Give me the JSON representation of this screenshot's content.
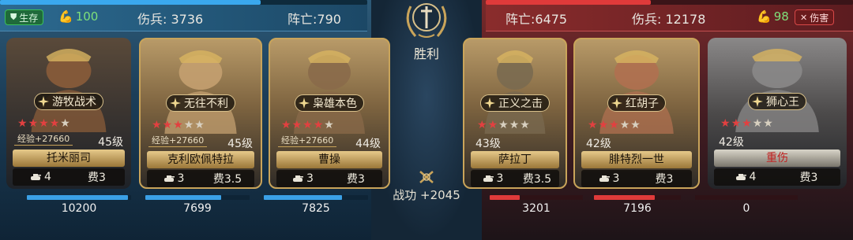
{
  "left": {
    "status_label": "生存",
    "capacity": "100",
    "wounded": "伤兵: 3736",
    "dead": "阵亡:790",
    "hp_fill": 0.71,
    "generals": [
      {
        "skill": "游牧战术",
        "stars_on": 4,
        "stars_total": 5,
        "exp": "经验+27660",
        "level": "45级",
        "name": "托米丽司",
        "troop_count": "4",
        "cost": "费3",
        "troops": "10200",
        "troop_fill": 0.97
      },
      {
        "skill": "无往不利",
        "stars_on": 3,
        "stars_total": 5,
        "exp": "经验+27660",
        "level": "45级",
        "name": "克利欧佩特拉",
        "troop_count": "3",
        "cost": "费3.5",
        "troops": "7699",
        "troop_fill": 0.73
      },
      {
        "skill": "枭雄本色",
        "stars_on": 4,
        "stars_total": 5,
        "exp": "经验+27660",
        "level": "44级",
        "name": "曹操",
        "troop_count": "3",
        "cost": "费3",
        "troops": "7825",
        "troop_fill": 0.75
      }
    ]
  },
  "right": {
    "status_label": "伤害",
    "capacity": "98",
    "wounded": "伤兵: 12178",
    "dead": "阵亡:6475",
    "hp_fill": 0.45,
    "generals": [
      {
        "skill": "正义之击",
        "stars_on": 2,
        "stars_total": 5,
        "level": "43级",
        "name": "萨拉丁",
        "troop_count": "3",
        "cost": "费3.5",
        "troops": "3201",
        "troop_fill": 0.32
      },
      {
        "skill": "红胡子",
        "stars_on": 3,
        "stars_total": 5,
        "level": "42级",
        "name": "腓特烈一世",
        "troop_count": "3",
        "cost": "费3",
        "troops": "7196",
        "troop_fill": 0.7
      },
      {
        "skill": "狮心王",
        "stars_on": 3,
        "stars_total": 5,
        "level": "42级",
        "name": "重伤",
        "troop_count": "4",
        "cost": "费3",
        "troops": "0",
        "troop_fill": 0.0
      }
    ]
  },
  "center": {
    "result": "胜利",
    "merit": "战功 +2045"
  },
  "colors": {
    "ally": "#3aa0e6",
    "enemy": "#e03a3a",
    "gold": "#c9a45a",
    "survive": "#3cbf5c"
  }
}
